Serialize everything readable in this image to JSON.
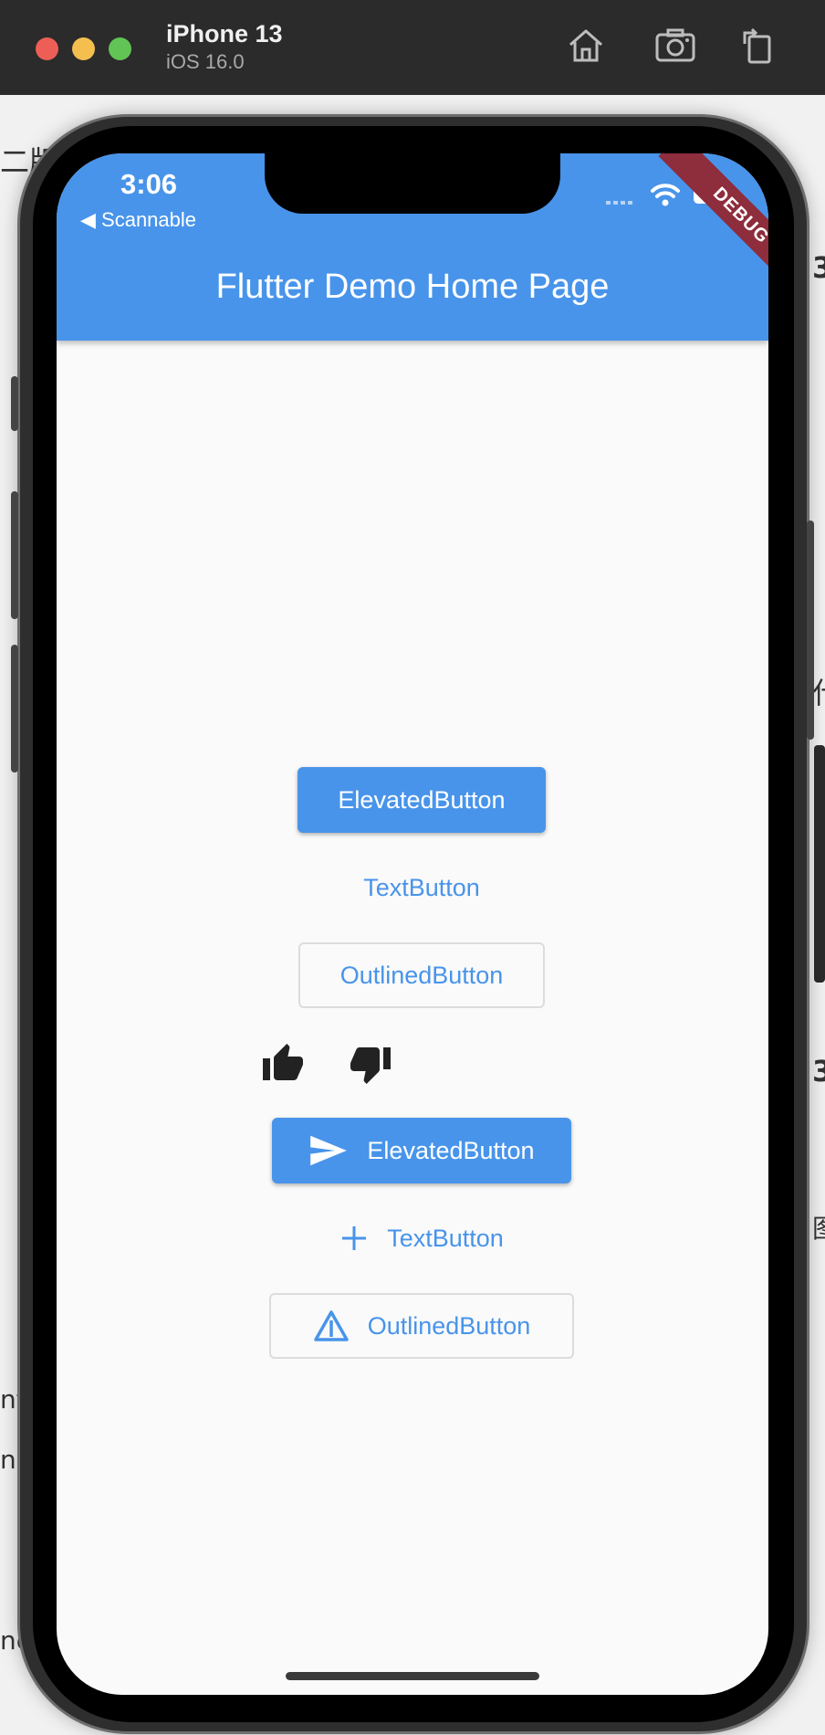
{
  "simulator": {
    "device_name": "iPhone 13",
    "os_version": "iOS 16.0",
    "icons": [
      "home-icon",
      "screenshot-icon",
      "rotate-icon"
    ]
  },
  "background_text": {
    "top_left": "二版",
    "right_1": "3",
    "right_2": "什",
    "right_3": "3",
    "right_4": "图",
    "left_1": "nt",
    "left_2": "n",
    "left_3": "ne"
  },
  "status_bar": {
    "time": "3:06",
    "back_label": "◀ Scannable"
  },
  "app": {
    "title": "Flutter Demo Home Page",
    "debug_banner": "DEBUG",
    "accent_color": "#4894ea"
  },
  "buttons": {
    "elevated_label": "ElevatedButton",
    "text_label": "TextButton",
    "outlined_label": "OutlinedButton",
    "thumb_up_icon": "thumb-up-icon",
    "thumb_down_icon": "thumb-down-icon",
    "elevated_icon_label": "ElevatedButton",
    "elevated_icon": "send-icon",
    "text_icon_label": "TextButton",
    "text_icon": "add-icon",
    "outlined_icon_label": "OutlinedButton",
    "outlined_icon": "warning-triangle-icon"
  }
}
